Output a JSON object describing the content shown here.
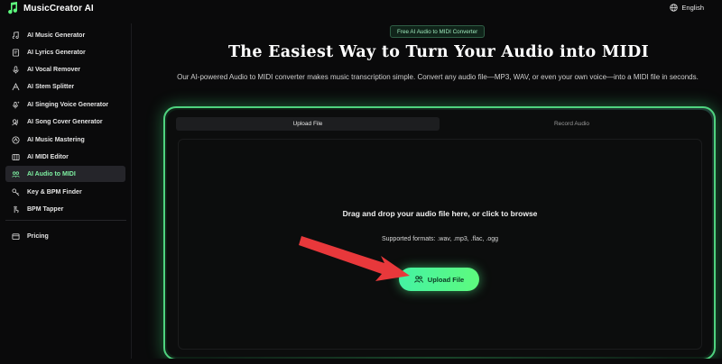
{
  "app": {
    "name": "MusicCreator AI",
    "language": "English"
  },
  "sidebar": {
    "items": [
      {
        "label": "AI Music Generator",
        "icon": "music-note-icon"
      },
      {
        "label": "AI Lyrics Generator",
        "icon": "document-icon"
      },
      {
        "label": "AI Vocal Remover",
        "icon": "microphone-icon"
      },
      {
        "label": "AI Stem Splitter",
        "icon": "split-icon"
      },
      {
        "label": "AI Singing Voice Generator",
        "icon": "sparkle-mic-icon"
      },
      {
        "label": "AI Song Cover Generator",
        "icon": "cover-icon"
      },
      {
        "label": "AI Music Mastering",
        "icon": "mastering-icon"
      },
      {
        "label": "AI MIDI Editor",
        "icon": "midi-editor-icon"
      },
      {
        "label": "AI Audio to MIDI",
        "icon": "audio-to-midi-icon",
        "active": true
      },
      {
        "label": "Key & BPM Finder",
        "icon": "key-icon"
      },
      {
        "label": "BPM Tapper",
        "icon": "tapper-icon"
      }
    ],
    "pricing": {
      "label": "Pricing",
      "icon": "pricing-icon"
    }
  },
  "main": {
    "badge": "Free AI Audio to MIDI Converter",
    "title": "The Easiest Way to Turn Your Audio into MIDI",
    "subtitle": "Our AI-powered Audio to MIDI converter makes music transcription simple. Convert any audio file—MP3, WAV, or even your own voice—into a MIDI file in seconds.",
    "tabs": [
      {
        "label": "Upload File",
        "active": true
      },
      {
        "label": "Record Audio",
        "active": false
      }
    ],
    "drop_text": "Drag and drop your audio file here, or click to browse",
    "formats": "Supported formats: .wav, .mp3, .flac, .ogg",
    "upload_button": "Upload File"
  },
  "colors": {
    "accent": "#5dfb7e",
    "accent_text": "#7ef0a2",
    "annotation_arrow": "#e8383b"
  }
}
